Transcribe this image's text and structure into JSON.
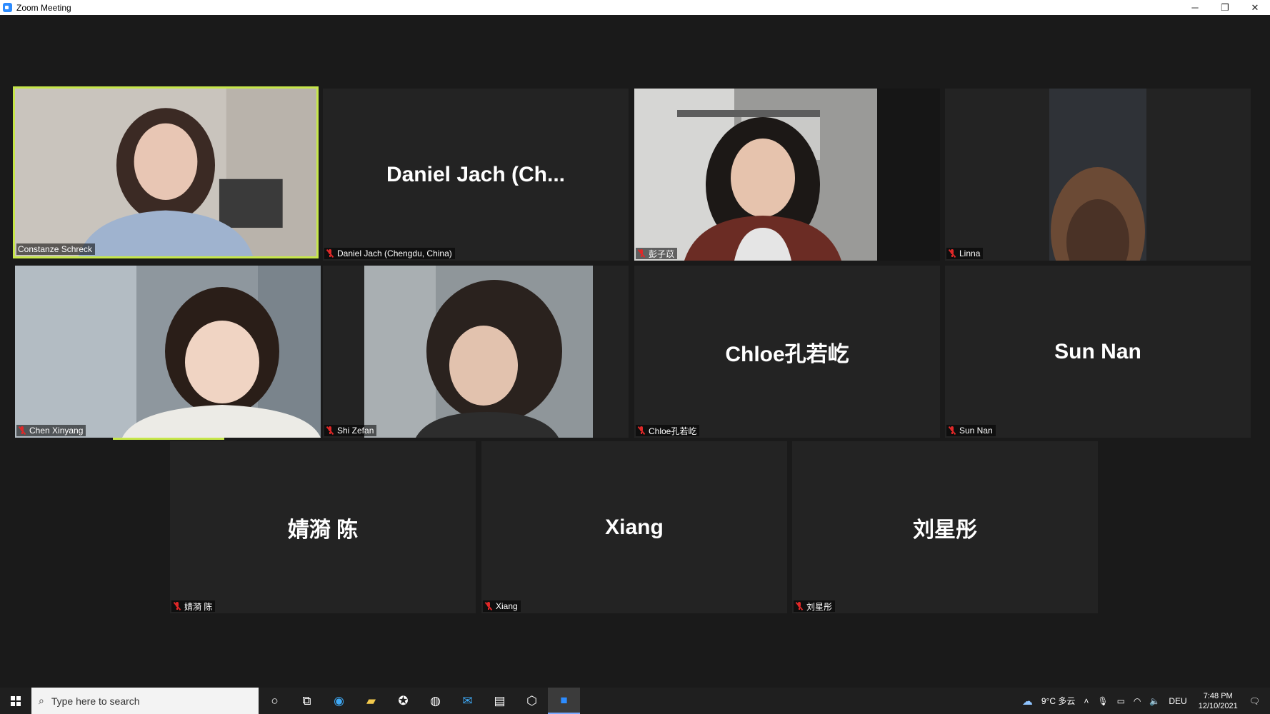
{
  "window": {
    "title": "Zoom Meeting"
  },
  "window_controls": {
    "minimize": "─",
    "restore": "❐",
    "close": "✕"
  },
  "participants": [
    {
      "name": "Constanze Schreck",
      "video": true,
      "muted": false,
      "active_speaker": true
    },
    {
      "name": "Daniel Jach (Chengdu, China)",
      "display_name": "Daniel Jach (Ch...",
      "video": false,
      "muted": true
    },
    {
      "name": "彭子苡",
      "video": true,
      "muted": true
    },
    {
      "name": "Linna",
      "video": true,
      "muted": true
    },
    {
      "name": "Chen Xinyang",
      "video": true,
      "muted": true
    },
    {
      "name": "Shi Zefan",
      "video": true,
      "muted": true
    },
    {
      "name": "Chloe孔若屹",
      "display_name": "Chloe孔若屹",
      "video": false,
      "muted": true
    },
    {
      "name": "Sun Nan",
      "display_name": "Sun Nan",
      "video": false,
      "muted": true
    },
    {
      "name": "婧漪 陈",
      "display_name": "婧漪 陈",
      "video": false,
      "muted": true
    },
    {
      "name": "Xiang",
      "display_name": "Xiang",
      "video": false,
      "muted": true
    },
    {
      "name": "刘星彤",
      "display_name": "刘星彤",
      "video": false,
      "muted": true
    }
  ],
  "taskbar": {
    "search_placeholder": "Type here to search",
    "weather": "9°C 多云",
    "language": "DEU",
    "time": "7:48 PM",
    "date": "12/10/2021"
  },
  "colors": {
    "active_speaker_border": "#c6e64a",
    "muted_icon": "#e02828",
    "tile_bg": "#232323"
  }
}
